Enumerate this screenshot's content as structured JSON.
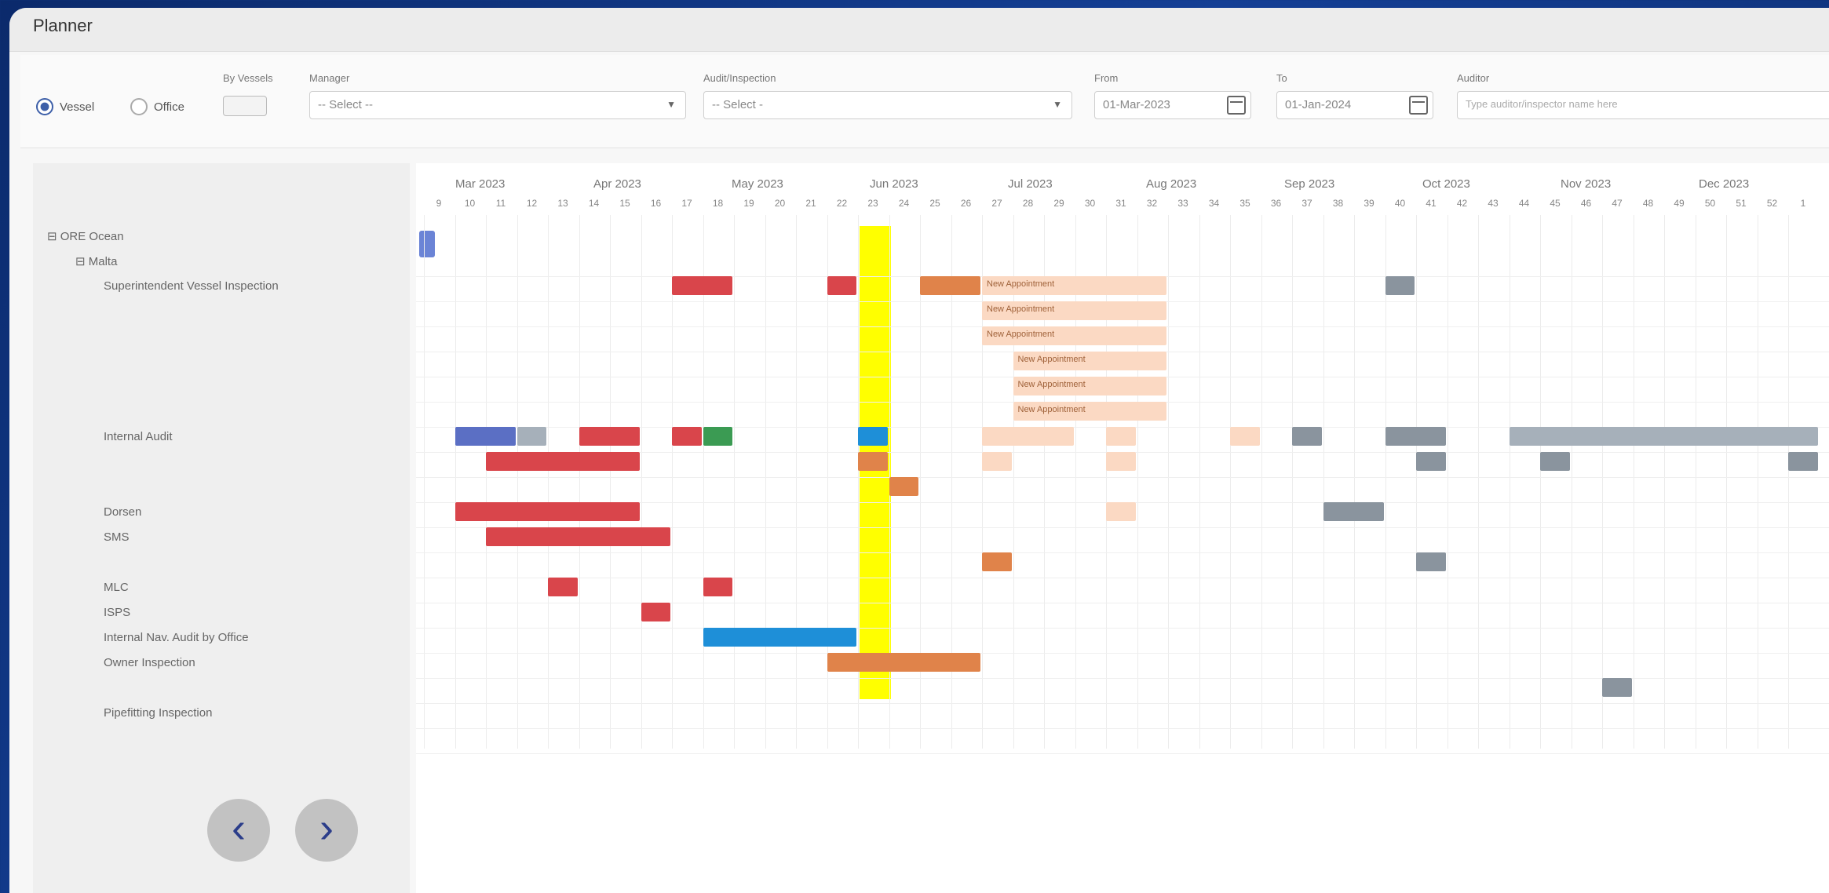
{
  "window": {
    "title": "Planner"
  },
  "filters": {
    "radio_vessel": "Vessel",
    "radio_office": "Office",
    "by_vessels_label": "By Vessels",
    "vessel_label": "Manager",
    "vessel_value": "-- Select --",
    "audit_label": "Audit/Inspection",
    "audit_value": "-- Select -",
    "from_label": "From",
    "from_value": "01-Mar-2023",
    "to_label": "To",
    "to_value": "01-Jan-2024",
    "auditor_label": "Auditor",
    "auditor_placeholder": "Type auditor/inspector name here"
  },
  "tree": [
    {
      "label": "⊟ ORE Ocean",
      "indent": 0
    },
    {
      "label": "⊟ Malta",
      "indent": 1
    },
    {
      "label": "Superintendent Vessel Inspection",
      "indent": 2
    },
    {
      "label": "Internal Audit",
      "indent": 2
    },
    {
      "label": "Dorsen",
      "indent": 2
    },
    {
      "label": "SMS",
      "indent": 2
    },
    {
      "label": "MLC",
      "indent": 2
    },
    {
      "label": "ISPS",
      "indent": 2
    },
    {
      "label": "Internal Nav. Audit by Office",
      "indent": 2
    },
    {
      "label": "Owner Inspection",
      "indent": 2
    },
    {
      "label": "Pipefitting Inspection",
      "indent": 2
    }
  ],
  "timeline": {
    "months": [
      "Mar 2023",
      "Apr 2023",
      "May 2023",
      "Jun 2023",
      "Jul 2023",
      "Aug 2023",
      "Sep 2023",
      "Oct 2023",
      "Nov 2023",
      "Dec 2023"
    ],
    "weeks": [
      "9",
      "10",
      "11",
      "12",
      "13",
      "14",
      "15",
      "16",
      "17",
      "18",
      "19",
      "20",
      "21",
      "22",
      "23",
      "24",
      "25",
      "26",
      "27",
      "28",
      "29",
      "30",
      "31",
      "32",
      "33",
      "34",
      "35",
      "36",
      "37",
      "38",
      "39",
      "40",
      "41",
      "42",
      "43",
      "44",
      "45",
      "46",
      "47",
      "48",
      "49",
      "50",
      "51",
      "52",
      "1"
    ]
  },
  "bars": [
    {
      "label": "",
      "color": "red",
      "col": 8,
      "span": 2,
      "row": 0
    },
    {
      "label": "",
      "color": "red",
      "col": 13,
      "span": 1,
      "row": 0
    },
    {
      "label": "",
      "color": "orange",
      "col": 16,
      "span": 2,
      "row": 0
    },
    {
      "label": "New Appointment",
      "color": "peach",
      "col": 18,
      "span": 6,
      "row": 0
    },
    {
      "label": "New Appointment",
      "color": "peach",
      "col": 18,
      "span": 6,
      "row": 1
    },
    {
      "label": "New Appointment",
      "color": "peach",
      "col": 18,
      "span": 6,
      "row": 2
    },
    {
      "label": "New Appointment",
      "color": "peach",
      "col": 19,
      "span": 5,
      "row": 3
    },
    {
      "label": "New Appointment",
      "color": "peach",
      "col": 19,
      "span": 5,
      "row": 4
    },
    {
      "label": "New Appointment",
      "color": "peach",
      "col": 19,
      "span": 5,
      "row": 5
    },
    {
      "label": "",
      "color": "gray",
      "col": 31,
      "span": 1,
      "row": 0
    },
    {
      "label": "",
      "color": "navy",
      "col": 1,
      "span": 2,
      "row": 6
    },
    {
      "label": "",
      "color": "silver",
      "col": 3,
      "span": 1,
      "row": 6
    },
    {
      "label": "",
      "color": "red",
      "col": 5,
      "span": 2,
      "row": 6
    },
    {
      "label": "",
      "color": "red",
      "col": 8,
      "span": 1,
      "row": 6
    },
    {
      "label": "",
      "color": "green",
      "col": 9,
      "span": 1,
      "row": 6
    },
    {
      "label": "",
      "color": "blue",
      "col": 14,
      "span": 1,
      "row": 6
    },
    {
      "label": "",
      "color": "peach",
      "col": 18,
      "span": 3,
      "row": 6
    },
    {
      "label": "",
      "color": "peach",
      "col": 22,
      "span": 1,
      "row": 6
    },
    {
      "label": "",
      "color": "peach",
      "col": 26,
      "span": 1,
      "row": 6
    },
    {
      "label": "",
      "color": "gray",
      "col": 28,
      "span": 1,
      "row": 6
    },
    {
      "label": "",
      "color": "gray",
      "col": 31,
      "span": 2,
      "row": 6
    },
    {
      "label": "",
      "color": "silver",
      "col": 35,
      "span": 10,
      "row": 6
    },
    {
      "label": "",
      "color": "red",
      "col": 2,
      "span": 5,
      "row": 7
    },
    {
      "label": "",
      "color": "orange",
      "col": 14,
      "span": 1,
      "row": 7
    },
    {
      "label": "",
      "color": "peach",
      "col": 18,
      "span": 1,
      "row": 7
    },
    {
      "label": "",
      "color": "peach",
      "col": 22,
      "span": 1,
      "row": 7
    },
    {
      "label": "",
      "color": "gray",
      "col": 32,
      "span": 1,
      "row": 7
    },
    {
      "label": "",
      "color": "gray",
      "col": 36,
      "span": 1,
      "row": 7
    },
    {
      "label": "",
      "color": "gray",
      "col": 44,
      "span": 1,
      "row": 7
    },
    {
      "label": "",
      "color": "orange",
      "col": 15,
      "span": 1,
      "row": 8
    },
    {
      "label": "",
      "color": "red",
      "col": 1,
      "span": 6,
      "row": 9
    },
    {
      "label": "",
      "color": "peach",
      "col": 22,
      "span": 1,
      "row": 9
    },
    {
      "label": "",
      "color": "gray",
      "col": 29,
      "span": 2,
      "row": 9
    },
    {
      "label": "",
      "color": "red",
      "col": 2,
      "span": 6,
      "row": 10
    },
    {
      "label": "",
      "color": "orange",
      "col": 18,
      "span": 1,
      "row": 11
    },
    {
      "label": "",
      "color": "gray",
      "col": 32,
      "span": 1,
      "row": 11
    },
    {
      "label": "",
      "color": "red",
      "col": 4,
      "span": 1,
      "row": 12
    },
    {
      "label": "",
      "color": "red",
      "col": 9,
      "span": 1,
      "row": 12
    },
    {
      "label": "",
      "color": "red",
      "col": 7,
      "span": 1,
      "row": 13
    },
    {
      "label": "",
      "color": "blue",
      "col": 9,
      "span": 5,
      "row": 14
    },
    {
      "label": "",
      "color": "orange",
      "col": 13,
      "span": 5,
      "row": 15
    },
    {
      "label": "",
      "color": "gray",
      "col": 38,
      "span": 1,
      "row": 16
    }
  ],
  "nav": {
    "prev": "‹",
    "next": "›"
  }
}
